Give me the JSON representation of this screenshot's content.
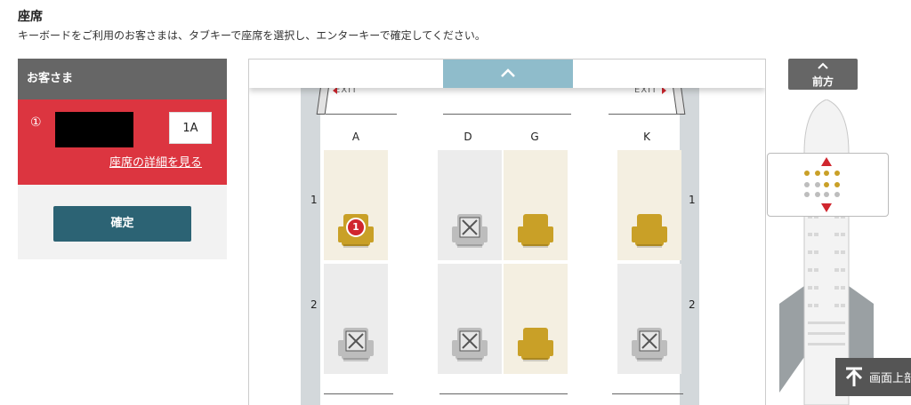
{
  "header": {
    "title": "座席",
    "instructions": "キーボードをご利用のお客さまは、タブキーで座席を選択し、エンターキーで確定してください。"
  },
  "passenger_panel": {
    "heading": "お客さま",
    "passengers": [
      {
        "number": "①",
        "seat": "1A",
        "details_link": "座席の詳細を見る"
      }
    ],
    "confirm_label": "確定"
  },
  "seat_map": {
    "exit_label": "EXIT",
    "columns": [
      "A",
      "D",
      "G",
      "K"
    ],
    "rows": [
      {
        "row": "1",
        "seats": {
          "A": "selected",
          "D": "unavailable",
          "G": "available",
          "K": "available"
        }
      },
      {
        "row": "2",
        "seats": {
          "A": "unavailable",
          "D": "unavailable",
          "G": "available",
          "K": "unavailable"
        }
      }
    ],
    "selected_badge": "1"
  },
  "side": {
    "front_label": "前方",
    "back_to_top_label": "画面上部"
  },
  "colors": {
    "passenger_red": "#dc3540",
    "confirm_teal": "#2c6374",
    "seat_gold": "#c9a027",
    "seat_grey": "#bdbdbd",
    "nav_blue": "#8fbccb"
  }
}
